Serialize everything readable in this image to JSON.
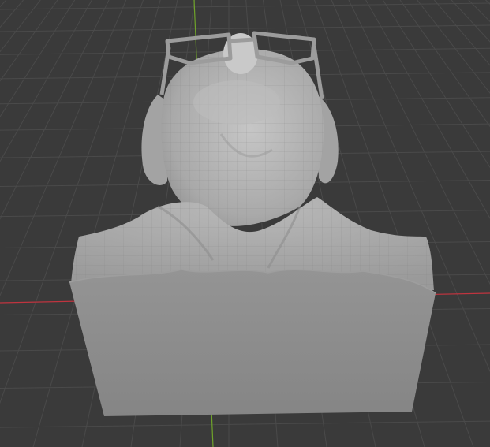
{
  "viewport": {
    "background": "#3a3a3a",
    "grid_color": "#4a4a4a",
    "x_axis_color": "#c0343f",
    "y_axis_color": "#6fa32a"
  },
  "model": {
    "kind": "sculpted head bust with glasses",
    "base_color": "#8c8c8c",
    "surface_color": "#b4b4b4",
    "wire_color": "#7e7e7e"
  }
}
